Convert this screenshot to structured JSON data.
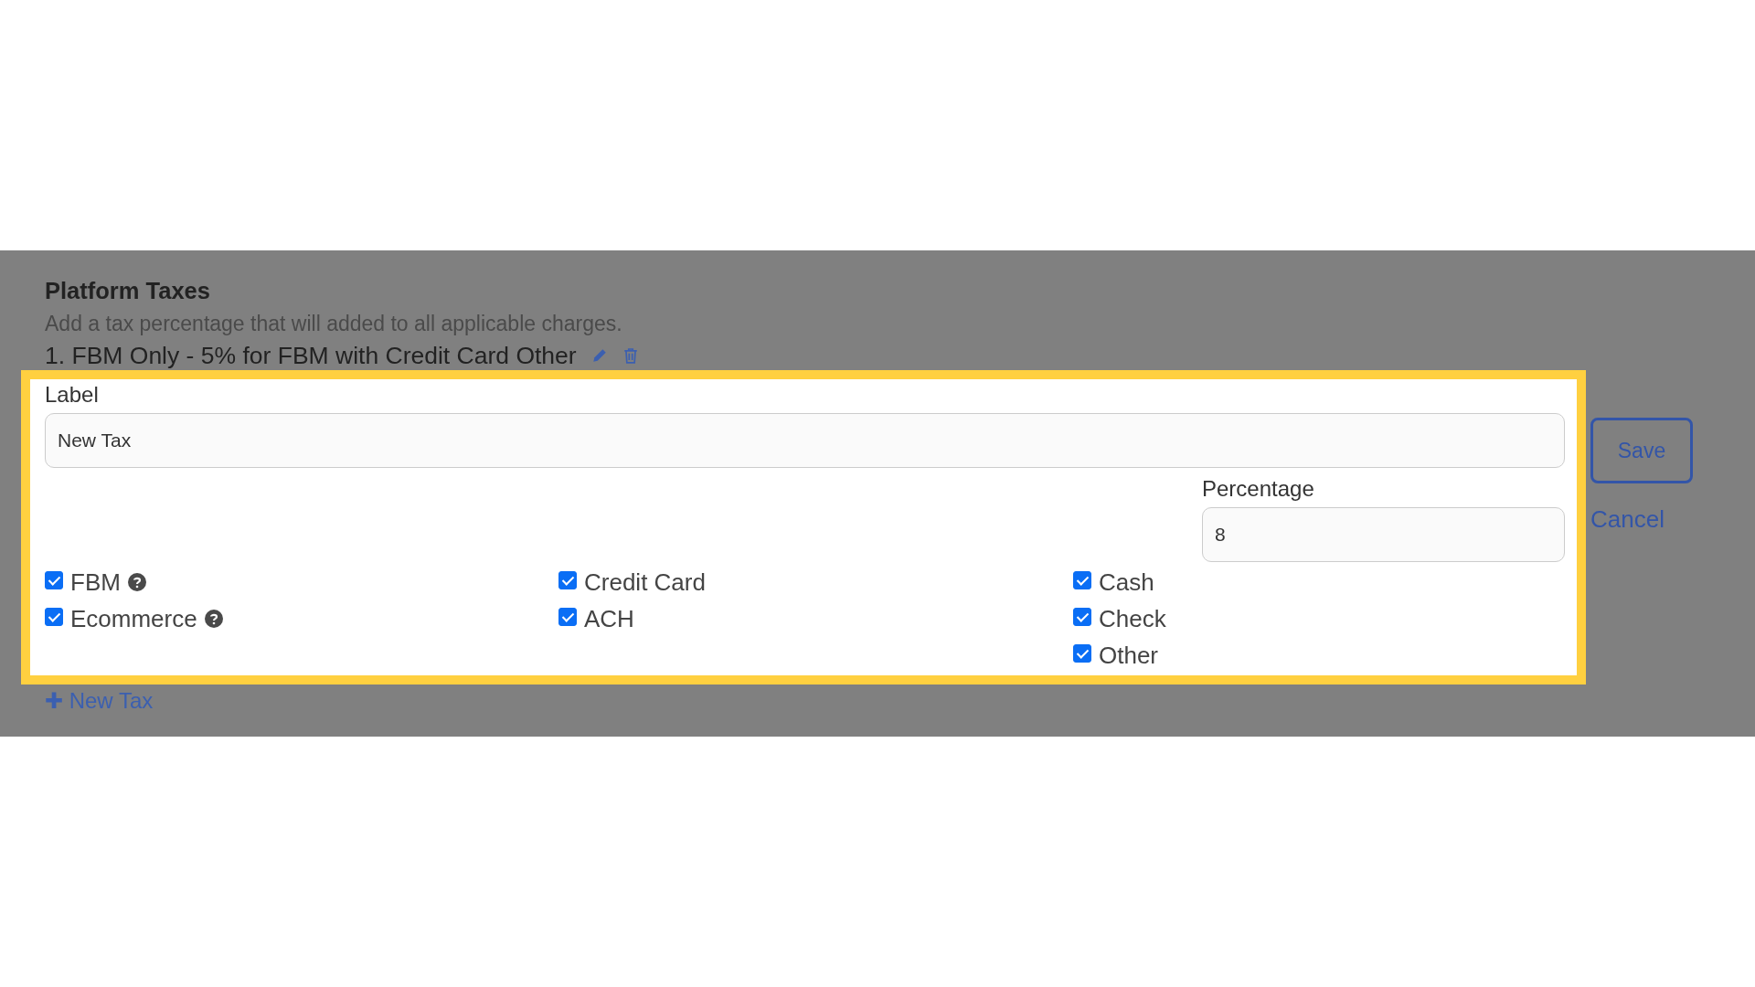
{
  "section": {
    "title": "Platform Taxes",
    "description": "Add a tax percentage that will added to all applicable charges.",
    "taxes": [
      {
        "label": "1. FBM Only - 5% for FBM with Credit Card Other"
      }
    ]
  },
  "form": {
    "label_field": {
      "label": "Label",
      "value": "New Tax"
    },
    "percentage_field": {
      "label": "Percentage",
      "value": "8"
    },
    "checkbox_columns": [
      [
        {
          "label": "FBM",
          "checked": true,
          "help": true
        },
        {
          "label": "Ecommerce",
          "checked": true,
          "help": true
        }
      ],
      [
        {
          "label": "Credit Card",
          "checked": true,
          "help": false
        },
        {
          "label": "ACH",
          "checked": true,
          "help": false
        }
      ],
      [
        {
          "label": "Cash",
          "checked": true,
          "help": false
        },
        {
          "label": "Check",
          "checked": true,
          "help": false
        },
        {
          "label": "Other",
          "checked": true,
          "help": false
        }
      ]
    ],
    "buttons": {
      "save": "Save",
      "cancel": "Cancel"
    }
  },
  "new_tax_link": {
    "icon": "✚",
    "label": "New Tax"
  }
}
